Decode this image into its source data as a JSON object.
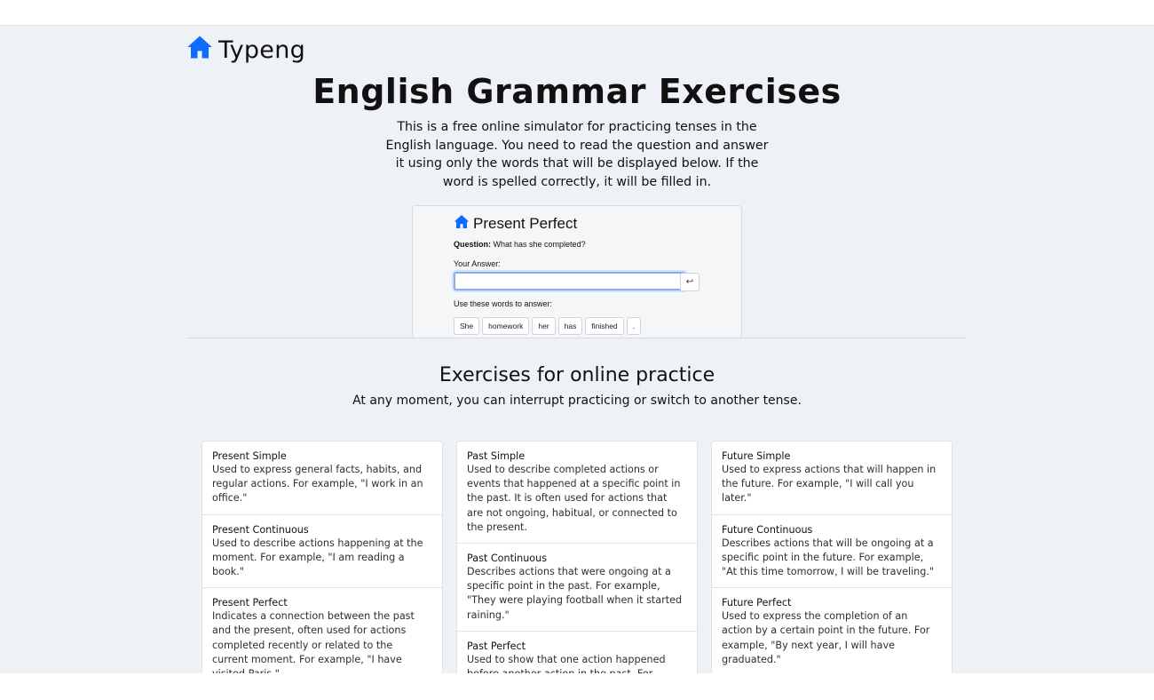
{
  "brand": {
    "name": "Typeng",
    "icon": "house-icon",
    "color": "#0d6efd"
  },
  "hero": {
    "title": "English Grammar Exercises",
    "description": "This is a free online simulator for practicing tenses in the English language. You need to read the question and answer it using only the words that will be displayed below. If the word is spelled correctly, it will be filled in."
  },
  "preview": {
    "title": "Present Perfect",
    "question_label": "Question:",
    "question_text": "What has she completed?",
    "answer_label": "Your Answer:",
    "answer_value": "",
    "enter_symbol": "↩",
    "hint": "Use these words to answer:",
    "words": [
      "She",
      "homework",
      "her",
      "has",
      "finished",
      "."
    ]
  },
  "exercises": {
    "title": "Exercises for online practice",
    "subtitle": "At any moment, you can interrupt practicing or switch to another tense.",
    "columns": [
      [
        {
          "title": "Present Simple",
          "desc": "Used to express general facts, habits, and regular actions. For example, \"I work in an office.\""
        },
        {
          "title": "Present Continuous",
          "desc": "Used to describe actions happening at the moment. For example, \"I am reading a book.\""
        },
        {
          "title": "Present Perfect",
          "desc": "Indicates a connection between the past and the present, often used for actions completed recently or related to the current moment. For example, \"I have visited Paris.\""
        }
      ],
      [
        {
          "title": "Past Simple",
          "desc": "Used to describe completed actions or events that happened at a specific point in the past. It is often used for actions that are not ongoing, habitual, or connected to the present."
        },
        {
          "title": "Past Continuous",
          "desc": "Describes actions that were ongoing at a specific point in the past. For example, \"They were playing football when it started raining.\""
        },
        {
          "title": "Past Perfect",
          "desc": "Used to show that one action happened before another action in the past. For example, \"She had left before I arrived.\""
        }
      ],
      [
        {
          "title": "Future Simple",
          "desc": "Used to express actions that will happen in the future. For example, \"I will call you later.\""
        },
        {
          "title": "Future Continuous",
          "desc": "Describes actions that will be ongoing at a specific point in the future. For example, \"At this time tomorrow, I will be traveling.\""
        },
        {
          "title": "Future Perfect",
          "desc": "Used to express the completion of an action by a certain point in the future. For example, \"By next year, I will have graduated.\""
        }
      ]
    ]
  }
}
